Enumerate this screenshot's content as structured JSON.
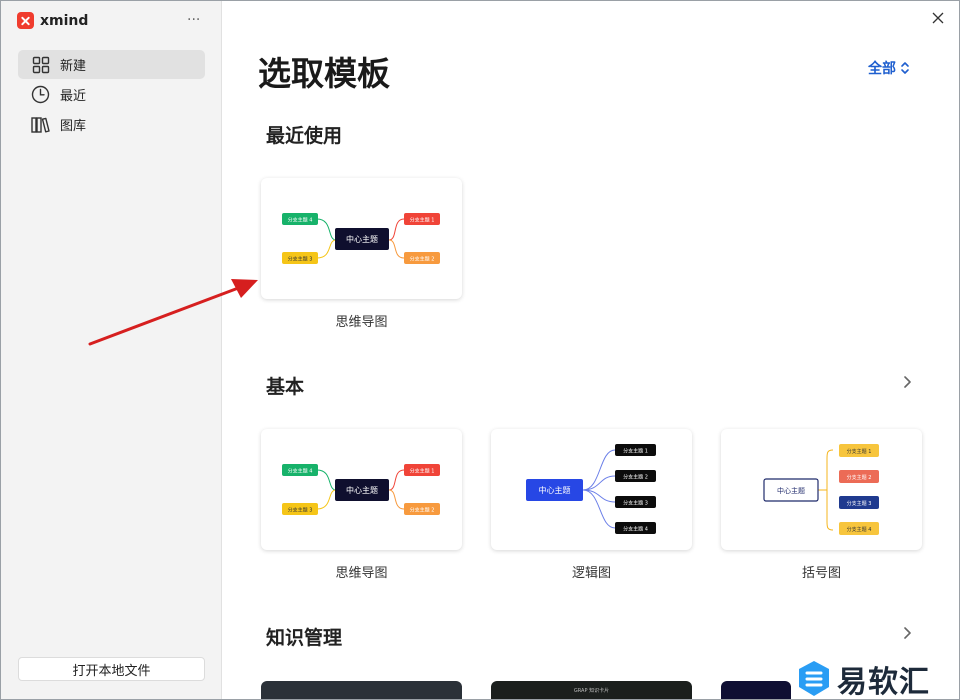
{
  "app": {
    "name": "xmind",
    "more_label": "···"
  },
  "sidebar": {
    "items": [
      {
        "label": "新建",
        "icon": "grid-icon",
        "active": true
      },
      {
        "label": "最近",
        "icon": "clock-icon",
        "active": false
      },
      {
        "label": "图库",
        "icon": "library-icon",
        "active": false
      }
    ],
    "open_local_label": "打开本地文件"
  },
  "header": {
    "title": "选取模板",
    "filter_label": "全部"
  },
  "sections": {
    "recent": {
      "title": "最近使用",
      "cards": [
        {
          "label": "思维导图"
        }
      ]
    },
    "basic": {
      "title": "基本",
      "cards": [
        {
          "label": "思维导图"
        },
        {
          "label": "逻辑图"
        },
        {
          "label": "括号图"
        }
      ]
    },
    "knowledge": {
      "title": "知识管理"
    }
  },
  "thumbnails": {
    "mindmap": {
      "center": "中心主题",
      "branch1": "分支主题 1",
      "branch2": "分支主题 2",
      "branch3": "分支主题 3",
      "branch4": "分支主题 4"
    },
    "logic": {
      "center": "中心主题",
      "branch1": "分支主题 1",
      "branch2": "分支主题 2",
      "branch3": "分支主题 3",
      "branch4": "分支主题 4"
    },
    "brace": {
      "center": "中心主题",
      "branch1": "分支主题 1",
      "branch2": "分支主题 2",
      "branch3": "分支主题 3",
      "branch4": "分支主题 4"
    }
  },
  "knowledge_preview": {
    "card2_text": "GRAP 知识卡片"
  },
  "watermark": {
    "text": "易软汇"
  },
  "colors": {
    "accent": "#1f5fcf",
    "dark_node": "#0f0f2e",
    "green": "#17b26a",
    "yellow": "#f5c518",
    "red": "#f04438",
    "orange": "#f79a3e",
    "logic_blue": "#2747e5",
    "annotation_arrow": "#d61f1f"
  }
}
